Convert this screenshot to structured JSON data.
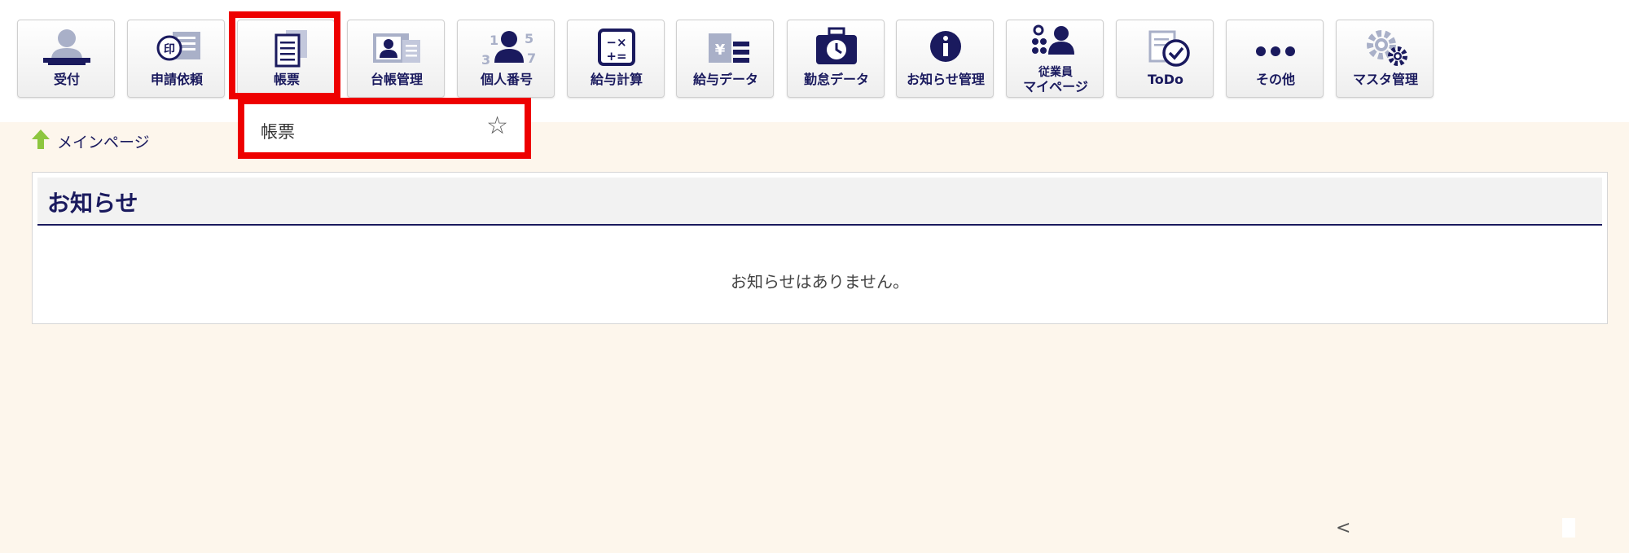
{
  "nav": {
    "items": [
      {
        "id": "uketsuke",
        "label": "受付",
        "icon": "reception-person-icon"
      },
      {
        "id": "shinsei",
        "label": "申請依頼",
        "icon": "stamp-document-icon"
      },
      {
        "id": "chohyo",
        "label": "帳票",
        "icon": "form-document-icon"
      },
      {
        "id": "daicho",
        "label": "台帳管理",
        "icon": "id-card-icon"
      },
      {
        "id": "kojin",
        "label": "個人番号",
        "icon": "person-numbers-icon"
      },
      {
        "id": "kyuyo-keisan",
        "label": "給与計算",
        "icon": "calculator-icon"
      },
      {
        "id": "kyuyo-data",
        "label": "給与データ",
        "icon": "yen-list-icon"
      },
      {
        "id": "kintai",
        "label": "勤怠データ",
        "icon": "clock-briefcase-icon"
      },
      {
        "id": "oshirase",
        "label": "お知らせ管理",
        "icon": "info-icon"
      },
      {
        "id": "mypage",
        "label_line1": "従業員",
        "label_line2": "マイページ",
        "icon": "employee-group-icon"
      },
      {
        "id": "todo",
        "label": "ToDo",
        "icon": "todo-check-icon"
      },
      {
        "id": "sonota",
        "label": "その他",
        "icon": "more-dots-icon"
      },
      {
        "id": "master",
        "label": "マスタ管理",
        "icon": "gears-icon"
      }
    ]
  },
  "dropdown": {
    "item_label": "帳票",
    "star_glyph": "☆"
  },
  "breadcrumb": {
    "label": "メインページ"
  },
  "notice": {
    "title": "お知らせ",
    "empty_message": "お知らせはありません。"
  },
  "pager": {
    "prev_glyph": "<"
  },
  "colors": {
    "navy": "#1a1a5e",
    "highlight": "#ee0000",
    "page_bg": "#fdf6ec",
    "home_green": "#8dc63f"
  }
}
